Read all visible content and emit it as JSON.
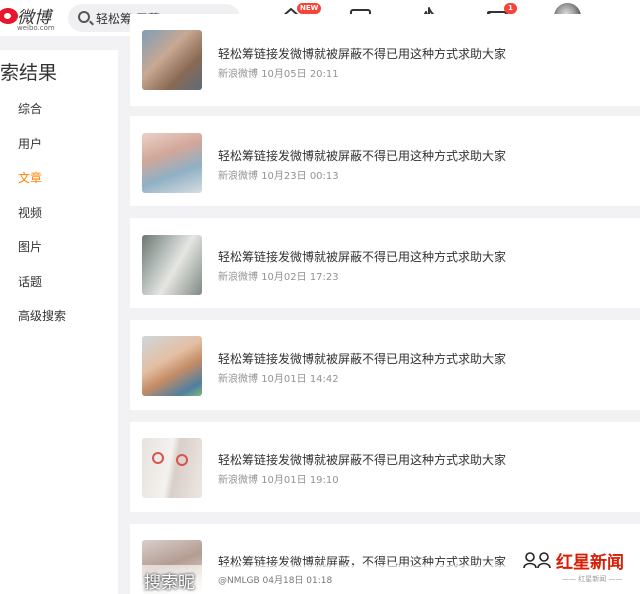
{
  "brand": {
    "logo_text": "微博",
    "logo_subtext": "weibo.com"
  },
  "search": {
    "query": "轻松筹 屏蔽"
  },
  "nav": {
    "home_badge": "NEW",
    "message_badge": "1"
  },
  "sidebar": {
    "title": "索结果",
    "items": [
      {
        "label": "综合"
      },
      {
        "label": "用户"
      },
      {
        "label": "文章",
        "active": true
      },
      {
        "label": "视频"
      },
      {
        "label": "图片"
      },
      {
        "label": "话题"
      },
      {
        "label": "高级搜索"
      }
    ]
  },
  "results": [
    {
      "title": "轻松筹链接发微博就被屏蔽不得已用这种方式求助大家",
      "source": "新浪微博",
      "time": "10月05日 20:11"
    },
    {
      "title": "轻松筹链接发微博就被屏蔽不得已用这种方式求助大家",
      "source": "新浪微博",
      "time": "10月23日 00:13"
    },
    {
      "title": "轻松筹链接发微博就被屏蔽不得已用这种方式求助大家",
      "source": "新浪微博",
      "time": "10月02日 17:23"
    },
    {
      "title": "轻松筹链接发微博就被屏蔽不得已用这种方式求助大家",
      "source": "新浪微博",
      "time": "10月01日 14:42"
    },
    {
      "title": "轻松筹链接发微博就被屏蔽不得已用这种方式求助大家",
      "source": "新浪微博",
      "time": "10月01日 19:10"
    },
    {
      "title": "轻松筹链接发微博就屏蔽，不得已用这种方式求助大家",
      "source": "",
      "time": ""
    }
  ],
  "overlay": {
    "label": "搜索昵",
    "sub": "@NMLGB 04月18日 01:18"
  },
  "watermark": {
    "text": "红星新闻",
    "sub": "—— 红星新闻 ——"
  },
  "colors": {
    "accent": "#ff8200",
    "brand_red": "#e6162d",
    "badge": "#f6443a"
  }
}
